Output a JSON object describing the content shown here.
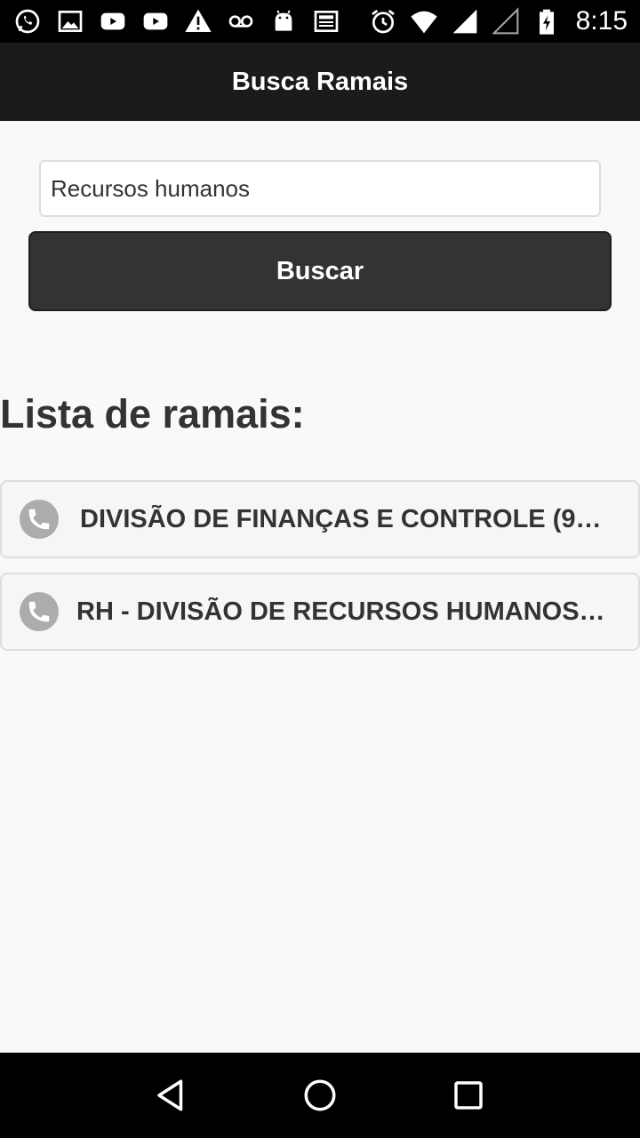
{
  "status_bar": {
    "notification_icons": [
      "whatsapp-icon",
      "image-icon",
      "youtube-icon",
      "youtube-icon",
      "warning-icon",
      "voicemail-icon",
      "android-icon",
      "news-icon"
    ],
    "system_icons": [
      "alarm-icon",
      "wifi-icon",
      "signal-icon",
      "signal-empty-icon",
      "battery-charging-icon"
    ],
    "time": "8:15"
  },
  "app_bar": {
    "title": "Busca Ramais"
  },
  "search": {
    "value": "Recursos humanos",
    "button_label": "Buscar"
  },
  "list": {
    "heading": "Lista de ramais:",
    "items": [
      {
        "label": "DIVISÃO DE FINANÇAS E CONTROLE (9…",
        "icon": "phone-icon"
      },
      {
        "label": "RH - DIVISÃO DE RECURSOS HUMANOS…",
        "icon": "phone-icon"
      }
    ]
  },
  "nav_bar": {
    "buttons": [
      "back-icon",
      "home-icon",
      "recents-icon"
    ]
  },
  "colors": {
    "app_bar": "#1b1b1b",
    "button": "#333333",
    "background": "#f9f9f9",
    "phone_icon_bg": "#acacac"
  }
}
